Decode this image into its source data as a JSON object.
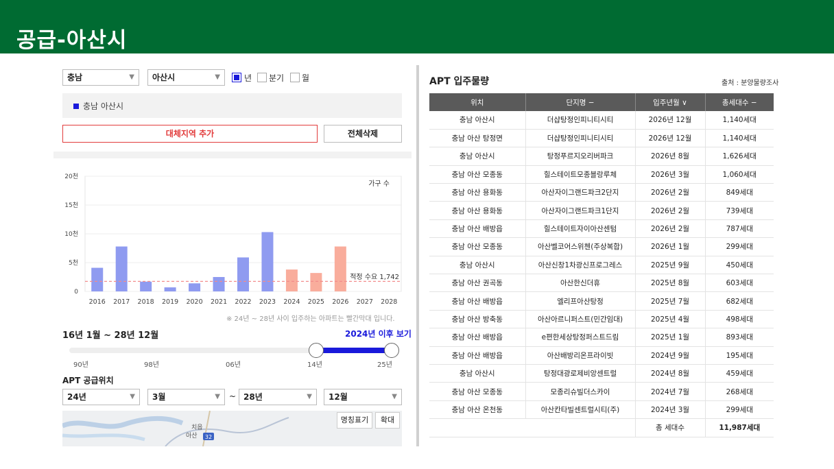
{
  "header": {
    "title": "공급-아산시"
  },
  "filters": {
    "province": "충남",
    "city": "아산시",
    "period_options": [
      {
        "label": "년",
        "checked": true
      },
      {
        "label": "분기",
        "checked": false
      },
      {
        "label": "월",
        "checked": false
      }
    ]
  },
  "region": {
    "selected": "충남 아산시"
  },
  "buttons": {
    "add_region": "대체지역 추가",
    "delete_all": "전체삭제"
  },
  "chart_data": {
    "type": "bar",
    "categories": [
      "2016",
      "2017",
      "2018",
      "2019",
      "2020",
      "2021",
      "2022",
      "2023",
      "2024",
      "2025",
      "2026",
      "2027",
      "2028"
    ],
    "values": [
      4100,
      7800,
      1700,
      700,
      1400,
      2500,
      5900,
      10300,
      3800,
      3200,
      7800,
      0,
      0
    ],
    "projected_from": "2024",
    "y_ticks": [
      "0",
      "5천",
      "10천",
      "15천",
      "20천"
    ],
    "ylim": [
      0,
      20000
    ],
    "legend": "가구 수",
    "reference_line": {
      "label": "적정 수요 1,742",
      "value": 1742
    },
    "note": "※ 24년 ~ 28년 사이 입주하는 아파트는 빨간막대 입니다.",
    "colors": {
      "past": "#8f9bf0",
      "future": "#f9ad9c",
      "reference": "#f28c8c"
    }
  },
  "range": {
    "title": "16년 1월 ~ 28년 12월",
    "link": "2024년 이후 보기",
    "ticks": [
      "90년",
      "98년",
      "06년",
      "14년",
      "25년"
    ],
    "selection_start": 0.765,
    "selection_end": 1.0
  },
  "apt_position": {
    "title": "APT 공급위치",
    "from_year": "24년",
    "from_month": "3월",
    "separator": "~",
    "to_year": "28년",
    "to_month": "12월"
  },
  "map": {
    "place": "아산",
    "place2": "치읍",
    "road_number": "32",
    "name_toggle": "명칭표기",
    "zoom": "확대"
  },
  "apt_table": {
    "title": "APT 입주물량",
    "source": "출처 : 분양물량조사",
    "headers": [
      "위치",
      "단지명 −",
      "입주년월 ∨",
      "총세대수 −"
    ],
    "rows": [
      [
        "충남 아산시",
        "더샵탕정인피니티시티",
        "2026년 12월",
        "1,140세대"
      ],
      [
        "충남 아산 탕정면",
        "더샵탕정인피니티시티",
        "2026년 12월",
        "1,140세대"
      ],
      [
        "충남 아산시",
        "탕정푸르지오리버파크",
        "2026년 8월",
        "1,626세대"
      ],
      [
        "충남 아산 모종동",
        "힐스테이트모종블랑루체",
        "2026년 3월",
        "1,060세대"
      ],
      [
        "충남 아산 용화동",
        "아산자이그랜드파크2단지",
        "2026년 2월",
        "849세대"
      ],
      [
        "충남 아산 용화동",
        "아산자이그랜드파크1단지",
        "2026년 2월",
        "739세대"
      ],
      [
        "충남 아산 배방읍",
        "힐스테이트자이아산센텀",
        "2026년 2월",
        "787세대"
      ],
      [
        "충남 아산 모종동",
        "아산벨코어스위첸(주상복합)",
        "2026년 1월",
        "299세대"
      ],
      [
        "충남 아산시",
        "아산신창1차광신프로그레스",
        "2025년 9월",
        "450세대"
      ],
      [
        "충남 아산 권곡동",
        "아산한신더휴",
        "2025년 8월",
        "603세대"
      ],
      [
        "충남 아산 배방읍",
        "엘리프아산탕정",
        "2025년 7월",
        "682세대"
      ],
      [
        "충남 아산 방축동",
        "아산아르니퍼스트(민간임대)",
        "2025년 4월",
        "498세대"
      ],
      [
        "충남 아산 배방읍",
        "e편한세상탕정퍼스트드림",
        "2025년 1월",
        "893세대"
      ],
      [
        "충남 아산 배방읍",
        "아산배방리온프라이빗",
        "2024년 9월",
        "195세대"
      ],
      [
        "충남 아산시",
        "탕정대광로제비앙센트럴",
        "2024년 8월",
        "459세대"
      ],
      [
        "충남 아산 모종동",
        "모종리슈빌더스카이",
        "2024년 7월",
        "268세대"
      ],
      [
        "충남 아산 온천동",
        "아산칸타빌센트럴시티(주)",
        "2024년 3월",
        "299세대"
      ]
    ],
    "total_label": "총 세대수",
    "total_value": "11,987세대"
  }
}
